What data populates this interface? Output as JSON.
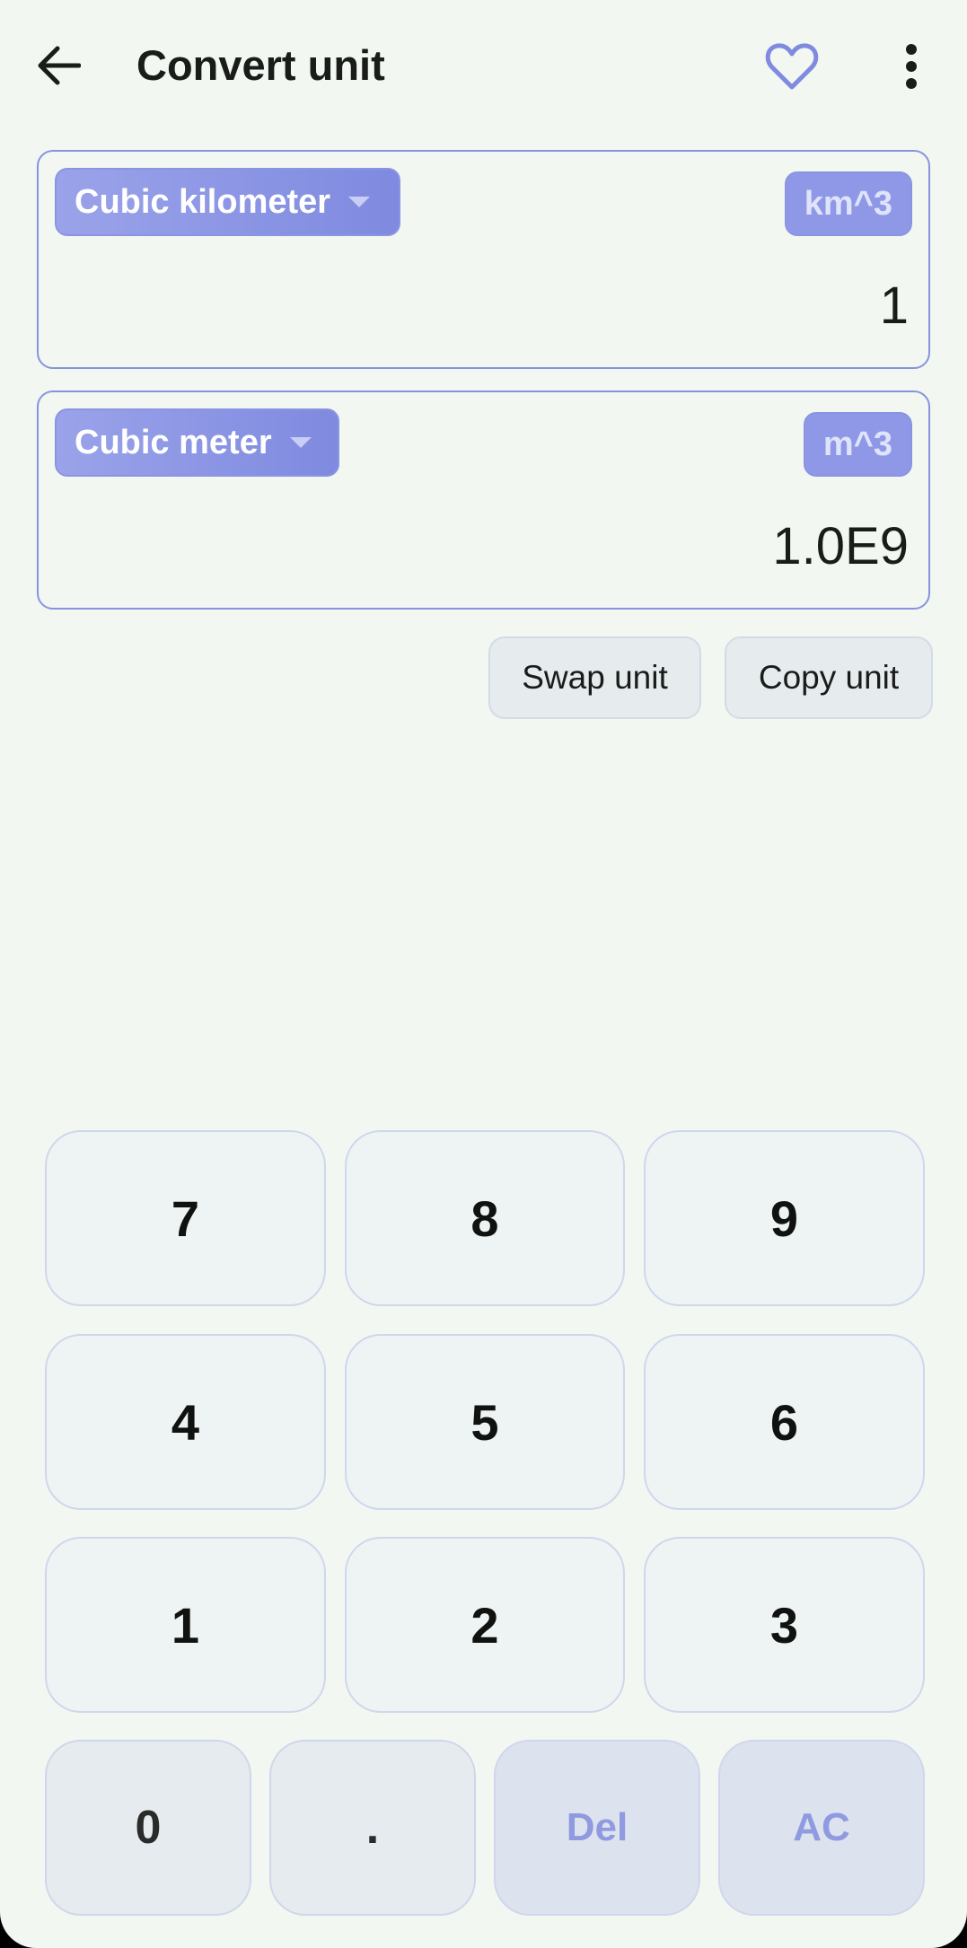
{
  "appbar": {
    "title": "Convert unit",
    "back_icon": "arrow-back-icon",
    "favorite_icon": "heart-outline-icon",
    "more_icon": "more-vert-icon"
  },
  "from_unit": {
    "name": "Cubic kilometer",
    "symbol": "km^3",
    "value": "1"
  },
  "to_unit": {
    "name": "Cubic meter",
    "symbol": "m^3",
    "value": "1.0E9"
  },
  "actions": {
    "swap_label": "Swap unit",
    "copy_label": "Copy unit"
  },
  "keypad": {
    "row1": [
      "7",
      "8",
      "9"
    ],
    "row2": [
      "4",
      "5",
      "6"
    ],
    "row3": [
      "1",
      "2",
      "3"
    ],
    "row4": [
      "0",
      ".",
      "Del",
      "AC"
    ]
  },
  "colors": {
    "background": "#f2f7f2",
    "accent": "#7f8ae0",
    "card_border": "#8794dd",
    "key_background": "#eef3f3",
    "accent_key_text": "#8f9ae0"
  }
}
